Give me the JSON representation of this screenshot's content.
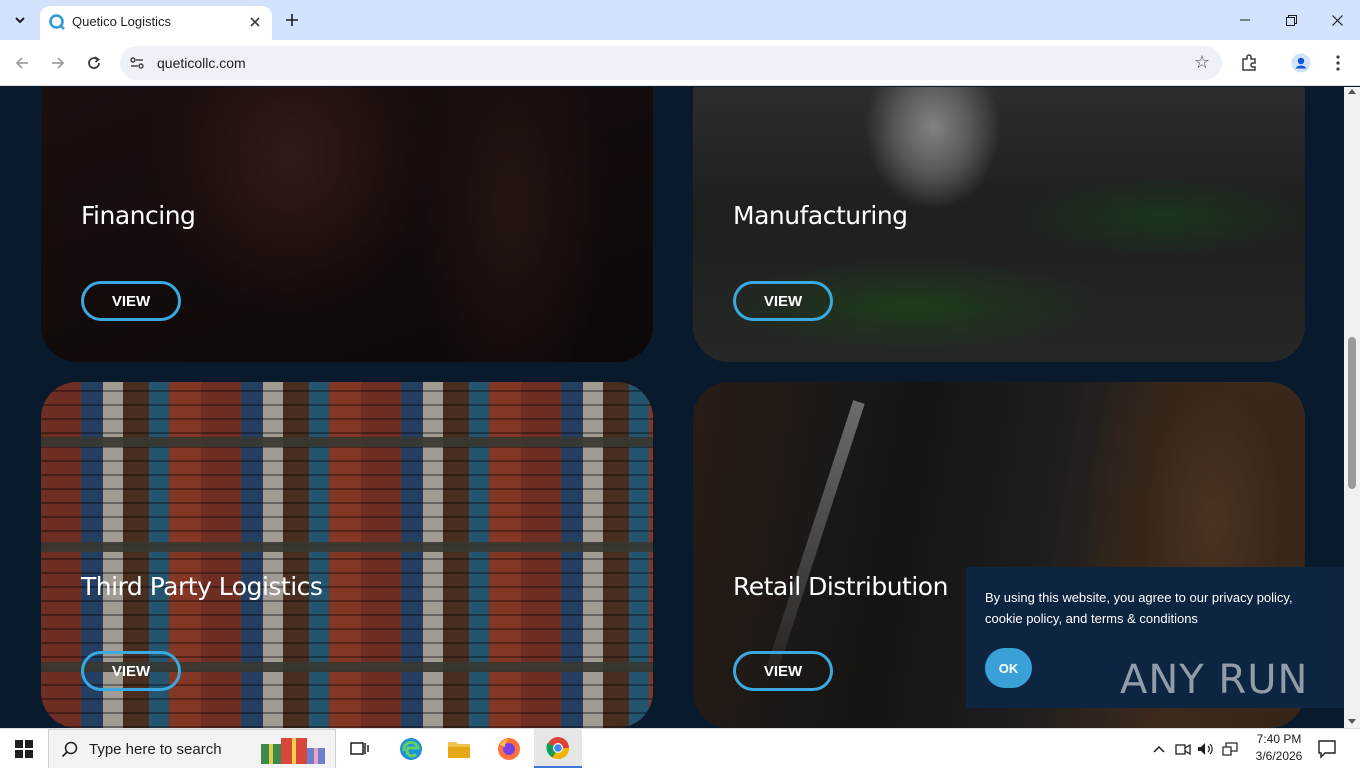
{
  "browser": {
    "tab_title": "Quetico Logistics",
    "url": "queticollc.com"
  },
  "cards": [
    {
      "title": "Financing",
      "button": "VIEW"
    },
    {
      "title": "Manufacturing",
      "button": "VIEW"
    },
    {
      "title": "Third Party Logistics",
      "button": "VIEW"
    },
    {
      "title": "Retail Distribution",
      "button": "VIEW"
    }
  ],
  "cookie_banner": {
    "text": "By using this website, you agree to our privacy policy, cookie policy, and terms & conditions",
    "ok_label": "OK"
  },
  "watermark": {
    "text": "ANY RUN"
  },
  "taskbar": {
    "search_placeholder": "Type here to search",
    "time": "7:40 PM",
    "date": "3/6/2026"
  },
  "colors": {
    "page_bg": "#0a1a2d",
    "accent": "#3aa9e0",
    "cookie_bg": "#0d2540",
    "tab_strip": "#d3e3fd"
  }
}
